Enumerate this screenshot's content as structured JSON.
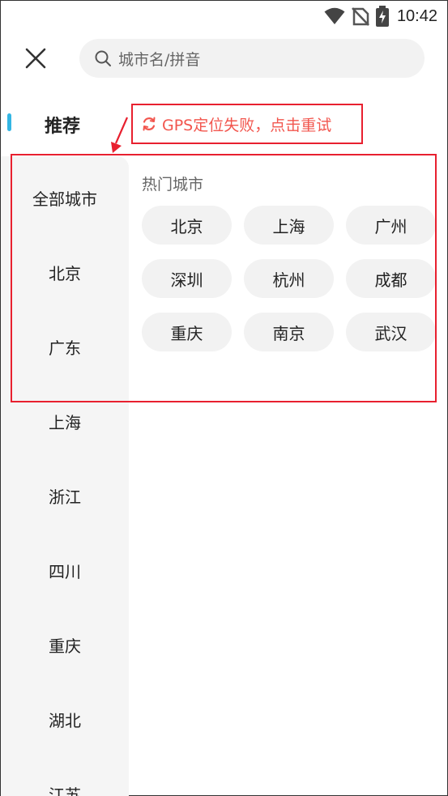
{
  "status_bar": {
    "time": "10:42",
    "icons": [
      "wifi-icon",
      "no-sim-icon",
      "battery-charging-icon"
    ]
  },
  "header": {
    "close_icon": "close-icon",
    "search": {
      "icon": "search-icon",
      "placeholder": "城市名/拼音"
    }
  },
  "recommend_tab": {
    "label": "推荐",
    "indicator_color": "#33b6e4"
  },
  "gps_status": {
    "icon": "refresh-icon",
    "text": "GPS定位失败，点击重试",
    "color": "#f2564e"
  },
  "sidebar": {
    "items": [
      {
        "label": "全部城市"
      },
      {
        "label": "北京"
      },
      {
        "label": "广东"
      },
      {
        "label": "上海"
      },
      {
        "label": "浙江"
      },
      {
        "label": "四川"
      },
      {
        "label": "重庆"
      },
      {
        "label": "湖北"
      },
      {
        "label": "江苏"
      }
    ]
  },
  "hot_cities": {
    "title": "热门城市",
    "cities": [
      {
        "name": "北京"
      },
      {
        "name": "上海"
      },
      {
        "name": "广州"
      },
      {
        "name": "深圳"
      },
      {
        "name": "杭州"
      },
      {
        "name": "成都"
      },
      {
        "name": "重庆"
      },
      {
        "name": "南京"
      },
      {
        "name": "武汉"
      }
    ]
  },
  "annotation_color": "#e8202f"
}
